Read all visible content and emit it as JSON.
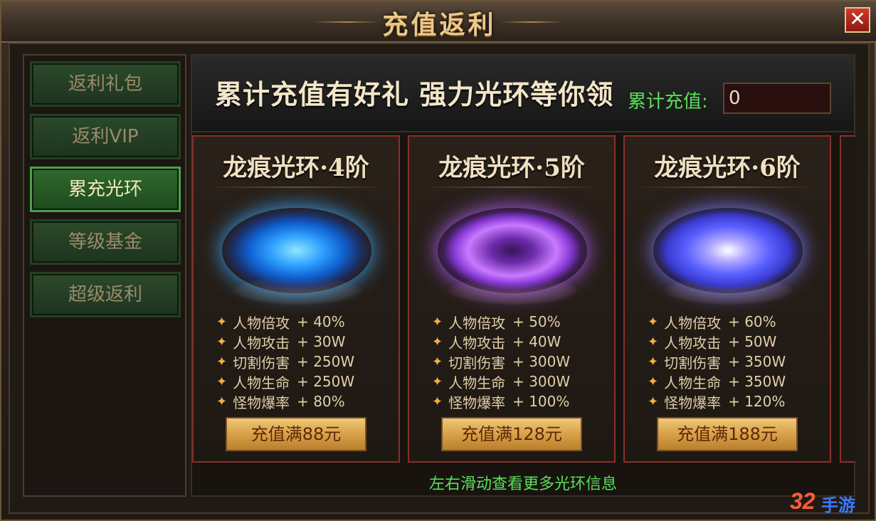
{
  "window": {
    "title": "充值返利",
    "close_label": "✕"
  },
  "sidebar": {
    "items": [
      {
        "label": "返利礼包",
        "active": false
      },
      {
        "label": "返利VIP",
        "active": false
      },
      {
        "label": "累充光环",
        "active": true
      },
      {
        "label": "等级基金",
        "active": false
      },
      {
        "label": "超级返利",
        "active": false
      }
    ]
  },
  "banner": {
    "headline": "累计充值有好礼 强力光环等你领",
    "total_label": "累计充值:",
    "total_value": "0"
  },
  "cards": [
    {
      "title": "龙痕光环·4阶",
      "ring_color": "blue",
      "stats": [
        {
          "name": "人物倍攻",
          "value": "+ 40%"
        },
        {
          "name": "人物攻击",
          "value": "+ 30W"
        },
        {
          "name": "切割伤害",
          "value": "+ 250W"
        },
        {
          "name": "人物生命",
          "value": "+ 250W"
        },
        {
          "name": "怪物爆率",
          "value": "+ 80%"
        }
      ],
      "button": "充值满88元"
    },
    {
      "title": "龙痕光环·5阶",
      "ring_color": "purple",
      "stats": [
        {
          "name": "人物倍攻",
          "value": "+ 50%"
        },
        {
          "name": "人物攻击",
          "value": "+ 40W"
        },
        {
          "name": "切割伤害",
          "value": "+ 300W"
        },
        {
          "name": "人物生命",
          "value": "+ 300W"
        },
        {
          "name": "怪物爆率",
          "value": "+ 100%"
        }
      ],
      "button": "充值满128元"
    },
    {
      "title": "龙痕光环·6阶",
      "ring_color": "violet",
      "stats": [
        {
          "name": "人物倍攻",
          "value": "+ 60%"
        },
        {
          "name": "人物攻击",
          "value": "+ 50W"
        },
        {
          "name": "切割伤害",
          "value": "+ 350W"
        },
        {
          "name": "人物生命",
          "value": "+ 350W"
        },
        {
          "name": "怪物爆率",
          "value": "+ 120%"
        }
      ],
      "button": "充值满188元"
    }
  ],
  "hint": "左右滑动查看更多光环信息",
  "watermark": {
    "number": "32",
    "text": "手游"
  }
}
